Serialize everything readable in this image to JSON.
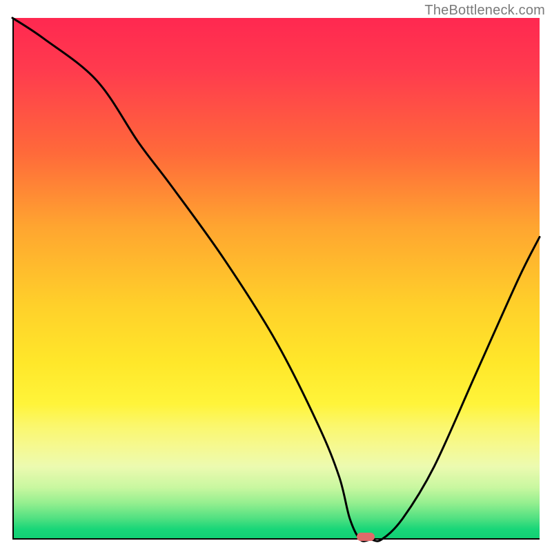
{
  "watermark": "TheBottleneck.com",
  "colors": {
    "gradient_top": "#ff2850",
    "gradient_bottom": "#10cf74",
    "curve": "#000000",
    "marker": "#e06a6a",
    "axis": "#000000"
  },
  "chart_data": {
    "type": "line",
    "title": "",
    "xlabel": "",
    "ylabel": "",
    "xlim": [
      0,
      100
    ],
    "ylim": [
      0,
      100
    ],
    "series": [
      {
        "name": "curve",
        "x": [
          0,
          6,
          16,
          24,
          30,
          40,
          50,
          58,
          62,
          64,
          66,
          68,
          70,
          74,
          80,
          88,
          96,
          100
        ],
        "values": [
          100,
          96,
          88,
          76,
          68,
          54,
          38,
          22,
          12,
          4,
          0,
          0,
          0,
          4,
          14,
          32,
          50,
          58
        ]
      }
    ],
    "marker": {
      "x": 67,
      "y": 0
    },
    "gradient_stops": [
      {
        "pos": 0.0,
        "color": "#ff2850"
      },
      {
        "pos": 0.26,
        "color": "#ff6a3a"
      },
      {
        "pos": 0.55,
        "color": "#ffd02a"
      },
      {
        "pos": 0.82,
        "color": "#f6f98f"
      },
      {
        "pos": 1.0,
        "color": "#10cf74"
      }
    ]
  }
}
